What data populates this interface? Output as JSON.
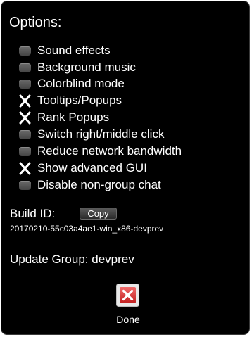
{
  "dialog": {
    "title": "Options:"
  },
  "options": [
    {
      "label": "Sound effects",
      "checked": false
    },
    {
      "label": "Background music",
      "checked": false
    },
    {
      "label": "Colorblind mode",
      "checked": false
    },
    {
      "label": "Tooltips/Popups",
      "checked": true
    },
    {
      "label": "Rank Popups",
      "checked": true
    },
    {
      "label": "Switch right/middle click",
      "checked": false
    },
    {
      "label": "Reduce network bandwidth",
      "checked": false
    },
    {
      "label": "Show advanced GUI",
      "checked": true
    },
    {
      "label": "Disable non-group chat",
      "checked": false
    }
  ],
  "build": {
    "label": "Build ID:",
    "copy_label": "Copy",
    "value": "20170210-55c03a4ae1-win_x86-devprev"
  },
  "update": {
    "text": "Update Group: devprev"
  },
  "done": {
    "label": "Done",
    "icon": "close-icon"
  },
  "colors": {
    "background": "#000000",
    "text": "#ffffff",
    "checkbox_off": "#555555",
    "done_red": "#d62b2b"
  }
}
